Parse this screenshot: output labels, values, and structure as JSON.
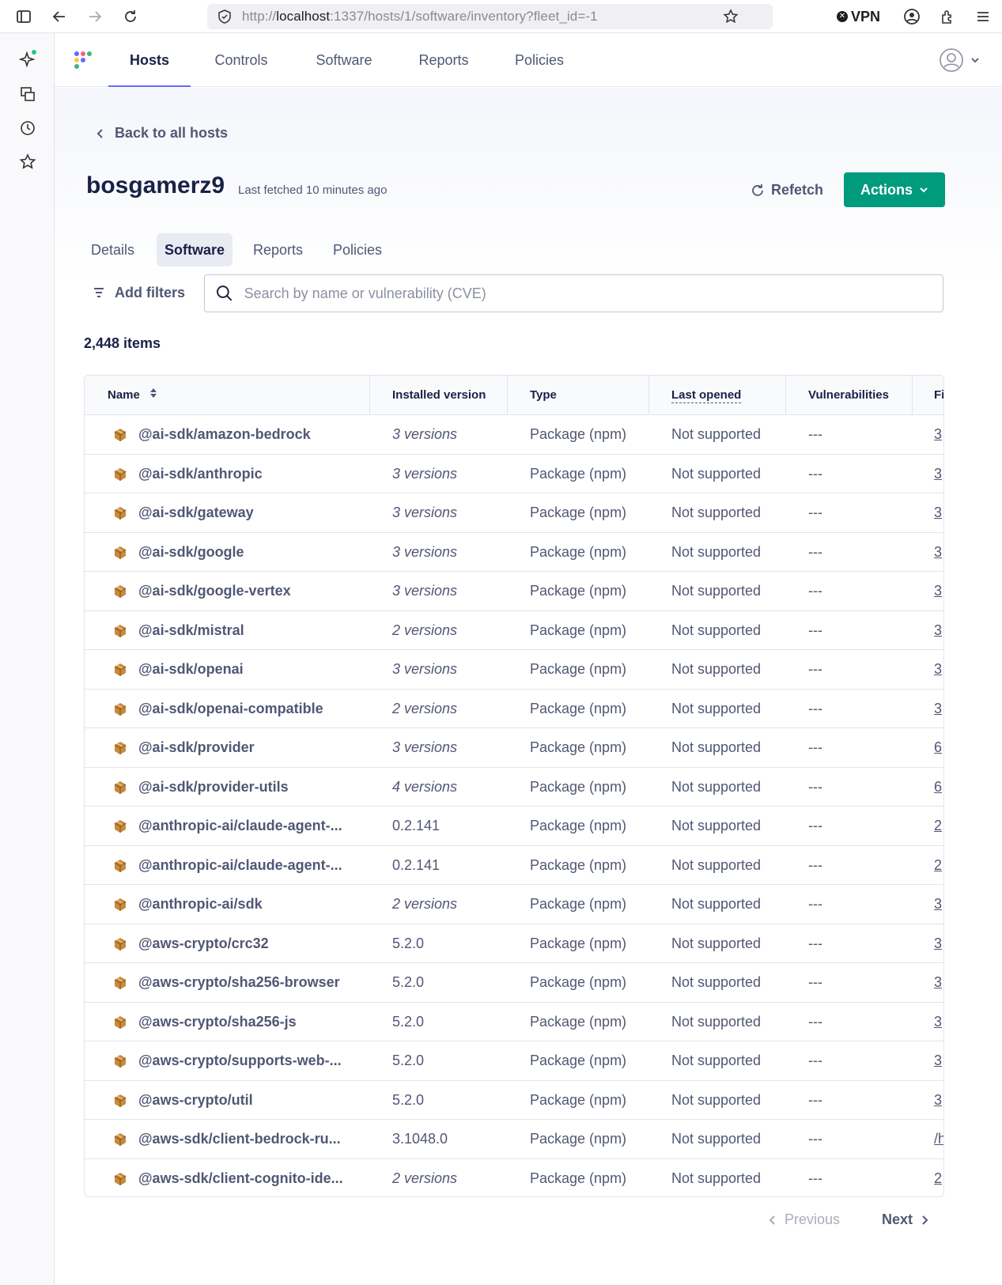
{
  "browser": {
    "url_prefix": "http://",
    "url_host": "localhost",
    "url_rest": ":1337/hosts/1/software/inventory?fleet_id=-1",
    "vpn_label": "VPN"
  },
  "nav": {
    "items": [
      {
        "label": "Hosts"
      },
      {
        "label": "Controls"
      },
      {
        "label": "Software"
      },
      {
        "label": "Reports"
      },
      {
        "label": "Policies"
      }
    ]
  },
  "page": {
    "back_label": "Back to all hosts",
    "host_name": "bosgamerz9",
    "last_fetched": "Last fetched 10 minutes ago",
    "refetch_label": "Refetch",
    "actions_label": "Actions",
    "subtabs": [
      {
        "label": "Details"
      },
      {
        "label": "Software"
      },
      {
        "label": "Reports"
      },
      {
        "label": "Policies"
      }
    ],
    "add_filters_label": "Add filters",
    "search_placeholder": "Search by name or vulnerability (CVE)",
    "item_count": "2,448 items"
  },
  "table": {
    "columns": [
      "Name",
      "Installed version",
      "Type",
      "Last opened",
      "Vulnerabilities",
      "Fi"
    ],
    "rows": [
      {
        "name": "@ai-sdk/amazon-bedrock",
        "version": "3 versions",
        "type": "Package (npm)",
        "last_opened": "Not supported",
        "vulns": "---",
        "file": "3"
      },
      {
        "name": "@ai-sdk/anthropic",
        "version": "3 versions",
        "type": "Package (npm)",
        "last_opened": "Not supported",
        "vulns": "---",
        "file": "3"
      },
      {
        "name": "@ai-sdk/gateway",
        "version": "3 versions",
        "type": "Package (npm)",
        "last_opened": "Not supported",
        "vulns": "---",
        "file": "3"
      },
      {
        "name": "@ai-sdk/google",
        "version": "3 versions",
        "type": "Package (npm)",
        "last_opened": "Not supported",
        "vulns": "---",
        "file": "3"
      },
      {
        "name": "@ai-sdk/google-vertex",
        "version": "3 versions",
        "type": "Package (npm)",
        "last_opened": "Not supported",
        "vulns": "---",
        "file": "3"
      },
      {
        "name": "@ai-sdk/mistral",
        "version": "2 versions",
        "type": "Package (npm)",
        "last_opened": "Not supported",
        "vulns": "---",
        "file": "3"
      },
      {
        "name": "@ai-sdk/openai",
        "version": "3 versions",
        "type": "Package (npm)",
        "last_opened": "Not supported",
        "vulns": "---",
        "file": "3"
      },
      {
        "name": "@ai-sdk/openai-compatible",
        "version": "2 versions",
        "type": "Package (npm)",
        "last_opened": "Not supported",
        "vulns": "---",
        "file": "3"
      },
      {
        "name": "@ai-sdk/provider",
        "version": "3 versions",
        "type": "Package (npm)",
        "last_opened": "Not supported",
        "vulns": "---",
        "file": "6"
      },
      {
        "name": "@ai-sdk/provider-utils",
        "version": "4 versions",
        "type": "Package (npm)",
        "last_opened": "Not supported",
        "vulns": "---",
        "file": "6"
      },
      {
        "name": "@anthropic-ai/claude-agent-...",
        "version": "0.2.141",
        "type": "Package (npm)",
        "last_opened": "Not supported",
        "vulns": "---",
        "file": "2"
      },
      {
        "name": "@anthropic-ai/claude-agent-...",
        "version": "0.2.141",
        "type": "Package (npm)",
        "last_opened": "Not supported",
        "vulns": "---",
        "file": "2"
      },
      {
        "name": "@anthropic-ai/sdk",
        "version": "2 versions",
        "type": "Package (npm)",
        "last_opened": "Not supported",
        "vulns": "---",
        "file": "3"
      },
      {
        "name": "@aws-crypto/crc32",
        "version": "5.2.0",
        "type": "Package (npm)",
        "last_opened": "Not supported",
        "vulns": "---",
        "file": "3"
      },
      {
        "name": "@aws-crypto/sha256-browser",
        "version": "5.2.0",
        "type": "Package (npm)",
        "last_opened": "Not supported",
        "vulns": "---",
        "file": "3"
      },
      {
        "name": "@aws-crypto/sha256-js",
        "version": "5.2.0",
        "type": "Package (npm)",
        "last_opened": "Not supported",
        "vulns": "---",
        "file": "3"
      },
      {
        "name": "@aws-crypto/supports-web-...",
        "version": "5.2.0",
        "type": "Package (npm)",
        "last_opened": "Not supported",
        "vulns": "---",
        "file": "3"
      },
      {
        "name": "@aws-crypto/util",
        "version": "5.2.0",
        "type": "Package (npm)",
        "last_opened": "Not supported",
        "vulns": "---",
        "file": "3"
      },
      {
        "name": "@aws-sdk/client-bedrock-ru...",
        "version": "3.1048.0",
        "type": "Package (npm)",
        "last_opened": "Not supported",
        "vulns": "---",
        "file": "/h"
      },
      {
        "name": "@aws-sdk/client-cognito-ide...",
        "version": "2 versions",
        "type": "Package (npm)",
        "last_opened": "Not supported",
        "vulns": "---",
        "file": "2"
      }
    ]
  },
  "pagination": {
    "previous_label": "Previous",
    "next_label": "Next"
  },
  "colors": {
    "accent": "#6a67fe",
    "actions_green": "#009a7d",
    "text_dark": "#192147",
    "text_muted": "#515774"
  }
}
